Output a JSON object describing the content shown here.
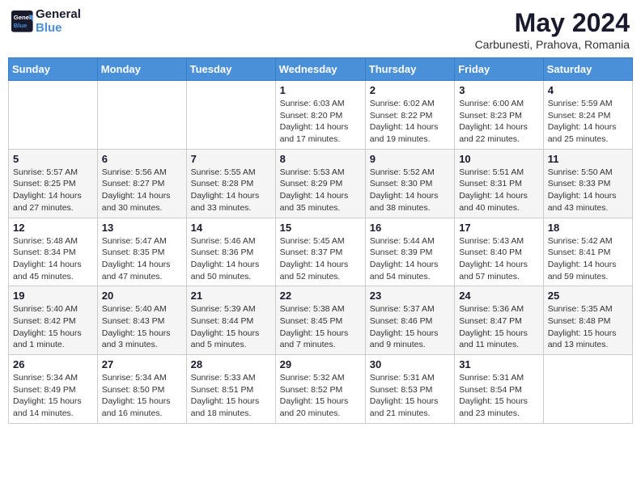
{
  "header": {
    "logo_line1": "General",
    "logo_line2": "Blue",
    "month": "May 2024",
    "location": "Carbunesti, Prahova, Romania"
  },
  "weekdays": [
    "Sunday",
    "Monday",
    "Tuesday",
    "Wednesday",
    "Thursday",
    "Friday",
    "Saturday"
  ],
  "weeks": [
    [
      {
        "day": "",
        "info": ""
      },
      {
        "day": "",
        "info": ""
      },
      {
        "day": "",
        "info": ""
      },
      {
        "day": "1",
        "info": "Sunrise: 6:03 AM\nSunset: 8:20 PM\nDaylight: 14 hours and 17 minutes."
      },
      {
        "day": "2",
        "info": "Sunrise: 6:02 AM\nSunset: 8:22 PM\nDaylight: 14 hours and 19 minutes."
      },
      {
        "day": "3",
        "info": "Sunrise: 6:00 AM\nSunset: 8:23 PM\nDaylight: 14 hours and 22 minutes."
      },
      {
        "day": "4",
        "info": "Sunrise: 5:59 AM\nSunset: 8:24 PM\nDaylight: 14 hours and 25 minutes."
      }
    ],
    [
      {
        "day": "5",
        "info": "Sunrise: 5:57 AM\nSunset: 8:25 PM\nDaylight: 14 hours and 27 minutes."
      },
      {
        "day": "6",
        "info": "Sunrise: 5:56 AM\nSunset: 8:27 PM\nDaylight: 14 hours and 30 minutes."
      },
      {
        "day": "7",
        "info": "Sunrise: 5:55 AM\nSunset: 8:28 PM\nDaylight: 14 hours and 33 minutes."
      },
      {
        "day": "8",
        "info": "Sunrise: 5:53 AM\nSunset: 8:29 PM\nDaylight: 14 hours and 35 minutes."
      },
      {
        "day": "9",
        "info": "Sunrise: 5:52 AM\nSunset: 8:30 PM\nDaylight: 14 hours and 38 minutes."
      },
      {
        "day": "10",
        "info": "Sunrise: 5:51 AM\nSunset: 8:31 PM\nDaylight: 14 hours and 40 minutes."
      },
      {
        "day": "11",
        "info": "Sunrise: 5:50 AM\nSunset: 8:33 PM\nDaylight: 14 hours and 43 minutes."
      }
    ],
    [
      {
        "day": "12",
        "info": "Sunrise: 5:48 AM\nSunset: 8:34 PM\nDaylight: 14 hours and 45 minutes."
      },
      {
        "day": "13",
        "info": "Sunrise: 5:47 AM\nSunset: 8:35 PM\nDaylight: 14 hours and 47 minutes."
      },
      {
        "day": "14",
        "info": "Sunrise: 5:46 AM\nSunset: 8:36 PM\nDaylight: 14 hours and 50 minutes."
      },
      {
        "day": "15",
        "info": "Sunrise: 5:45 AM\nSunset: 8:37 PM\nDaylight: 14 hours and 52 minutes."
      },
      {
        "day": "16",
        "info": "Sunrise: 5:44 AM\nSunset: 8:39 PM\nDaylight: 14 hours and 54 minutes."
      },
      {
        "day": "17",
        "info": "Sunrise: 5:43 AM\nSunset: 8:40 PM\nDaylight: 14 hours and 57 minutes."
      },
      {
        "day": "18",
        "info": "Sunrise: 5:42 AM\nSunset: 8:41 PM\nDaylight: 14 hours and 59 minutes."
      }
    ],
    [
      {
        "day": "19",
        "info": "Sunrise: 5:40 AM\nSunset: 8:42 PM\nDaylight: 15 hours and 1 minute."
      },
      {
        "day": "20",
        "info": "Sunrise: 5:40 AM\nSunset: 8:43 PM\nDaylight: 15 hours and 3 minutes."
      },
      {
        "day": "21",
        "info": "Sunrise: 5:39 AM\nSunset: 8:44 PM\nDaylight: 15 hours and 5 minutes."
      },
      {
        "day": "22",
        "info": "Sunrise: 5:38 AM\nSunset: 8:45 PM\nDaylight: 15 hours and 7 minutes."
      },
      {
        "day": "23",
        "info": "Sunrise: 5:37 AM\nSunset: 8:46 PM\nDaylight: 15 hours and 9 minutes."
      },
      {
        "day": "24",
        "info": "Sunrise: 5:36 AM\nSunset: 8:47 PM\nDaylight: 15 hours and 11 minutes."
      },
      {
        "day": "25",
        "info": "Sunrise: 5:35 AM\nSunset: 8:48 PM\nDaylight: 15 hours and 13 minutes."
      }
    ],
    [
      {
        "day": "26",
        "info": "Sunrise: 5:34 AM\nSunset: 8:49 PM\nDaylight: 15 hours and 14 minutes."
      },
      {
        "day": "27",
        "info": "Sunrise: 5:34 AM\nSunset: 8:50 PM\nDaylight: 15 hours and 16 minutes."
      },
      {
        "day": "28",
        "info": "Sunrise: 5:33 AM\nSunset: 8:51 PM\nDaylight: 15 hours and 18 minutes."
      },
      {
        "day": "29",
        "info": "Sunrise: 5:32 AM\nSunset: 8:52 PM\nDaylight: 15 hours and 20 minutes."
      },
      {
        "day": "30",
        "info": "Sunrise: 5:31 AM\nSunset: 8:53 PM\nDaylight: 15 hours and 21 minutes."
      },
      {
        "day": "31",
        "info": "Sunrise: 5:31 AM\nSunset: 8:54 PM\nDaylight: 15 hours and 23 minutes."
      },
      {
        "day": "",
        "info": ""
      }
    ]
  ]
}
